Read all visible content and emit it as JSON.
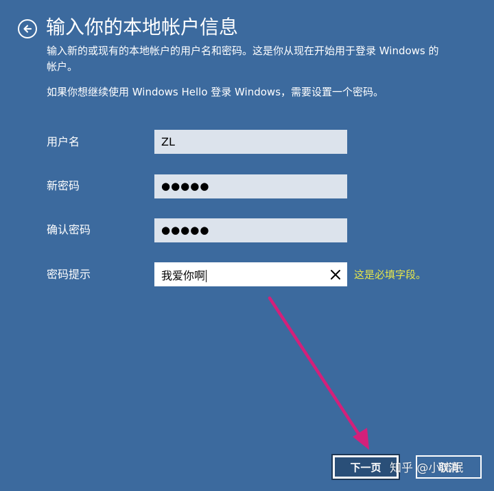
{
  "header": {
    "title": "输入你的本地帐户信息",
    "back_icon": "back-arrow-circle-icon"
  },
  "description": {
    "line1": "输入新的或现有的本地帐户的用户名和密码。这是你从现在开始用于登录 Windows 的",
    "line2": "帐户。",
    "line3": "如果你想继续使用 Windows Hello 登录 Windows，需要设置一个密码。"
  },
  "form": {
    "username": {
      "label": "用户名",
      "value": "ZL"
    },
    "new_password": {
      "label": "新密码",
      "value": "●●●●●"
    },
    "confirm_password": {
      "label": "确认密码",
      "value": "●●●●●"
    },
    "password_hint": {
      "label": "密码提示",
      "value": "我爱你啊",
      "clear_icon": "close-icon",
      "error": "这是必填字段。"
    }
  },
  "footer": {
    "next_label": "下一页",
    "cancel_label": "取消"
  },
  "watermark": "知乎 @小流氓",
  "colors": {
    "background": "#3c6a9e",
    "input_bg": "#dce3ec",
    "error_text": "#e6e64a",
    "annotation_arrow": "#d3207a"
  }
}
